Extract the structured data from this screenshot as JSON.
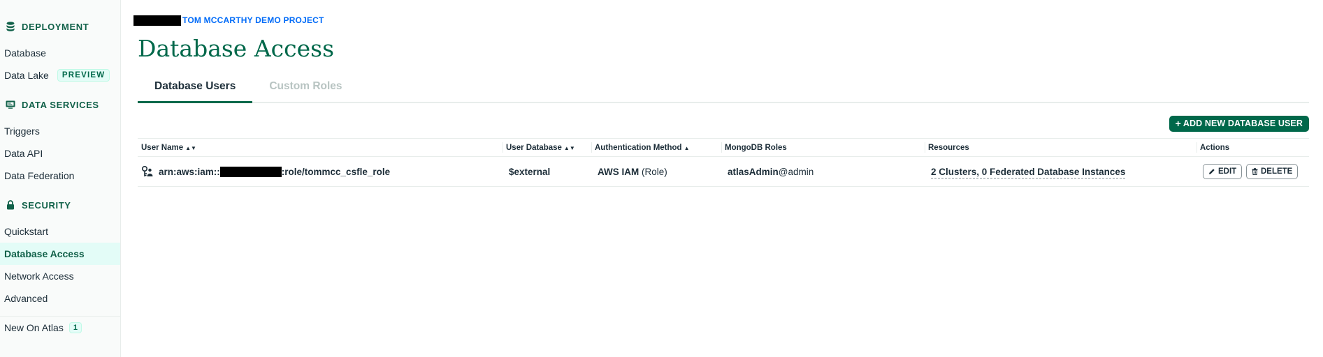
{
  "colors": {
    "brand": "#00684a",
    "link": "#016bf8",
    "sidebar_bg": "#f9fbfa",
    "active_bg": "#e3fcf7"
  },
  "sidebar": {
    "sections": [
      {
        "icon": "database-stack-icon",
        "title": "DEPLOYMENT",
        "items": [
          {
            "label": "Database"
          },
          {
            "label": "Data Lake",
            "badge": "PREVIEW"
          }
        ]
      },
      {
        "icon": "monitor-icon",
        "title": "DATA SERVICES",
        "items": [
          {
            "label": "Triggers"
          },
          {
            "label": "Data API"
          },
          {
            "label": "Data Federation"
          }
        ]
      },
      {
        "icon": "lock-icon",
        "title": "SECURITY",
        "items": [
          {
            "label": "Quickstart"
          },
          {
            "label": "Database Access",
            "active": true
          },
          {
            "label": "Network Access"
          },
          {
            "label": "Advanced"
          }
        ]
      }
    ],
    "footer": {
      "label": "New On Atlas",
      "count": "1"
    }
  },
  "breadcrumb": {
    "project": "TOM MCCARTHY DEMO PROJECT"
  },
  "page_title": "Database Access",
  "tabs": [
    {
      "label": "Database Users",
      "active": true
    },
    {
      "label": "Custom Roles",
      "active": false
    }
  ],
  "toolbar": {
    "add_label": "ADD NEW DATABASE USER"
  },
  "table": {
    "columns": [
      "User Name",
      "User Database",
      "Authentication Method",
      "MongoDB Roles",
      "Resources",
      "Actions"
    ],
    "rows": [
      {
        "user_prefix": "arn:aws:iam::",
        "user_suffix": ":role/tommcc_csfle_role",
        "user_database": "$external",
        "auth_method": "AWS IAM",
        "auth_type": "(Role)",
        "role_name": "atlasAdmin",
        "role_db": "@admin",
        "resources": "2 Clusters, 0 Federated Database Instances",
        "edit_label": "EDIT",
        "delete_label": "DELETE"
      }
    ]
  }
}
